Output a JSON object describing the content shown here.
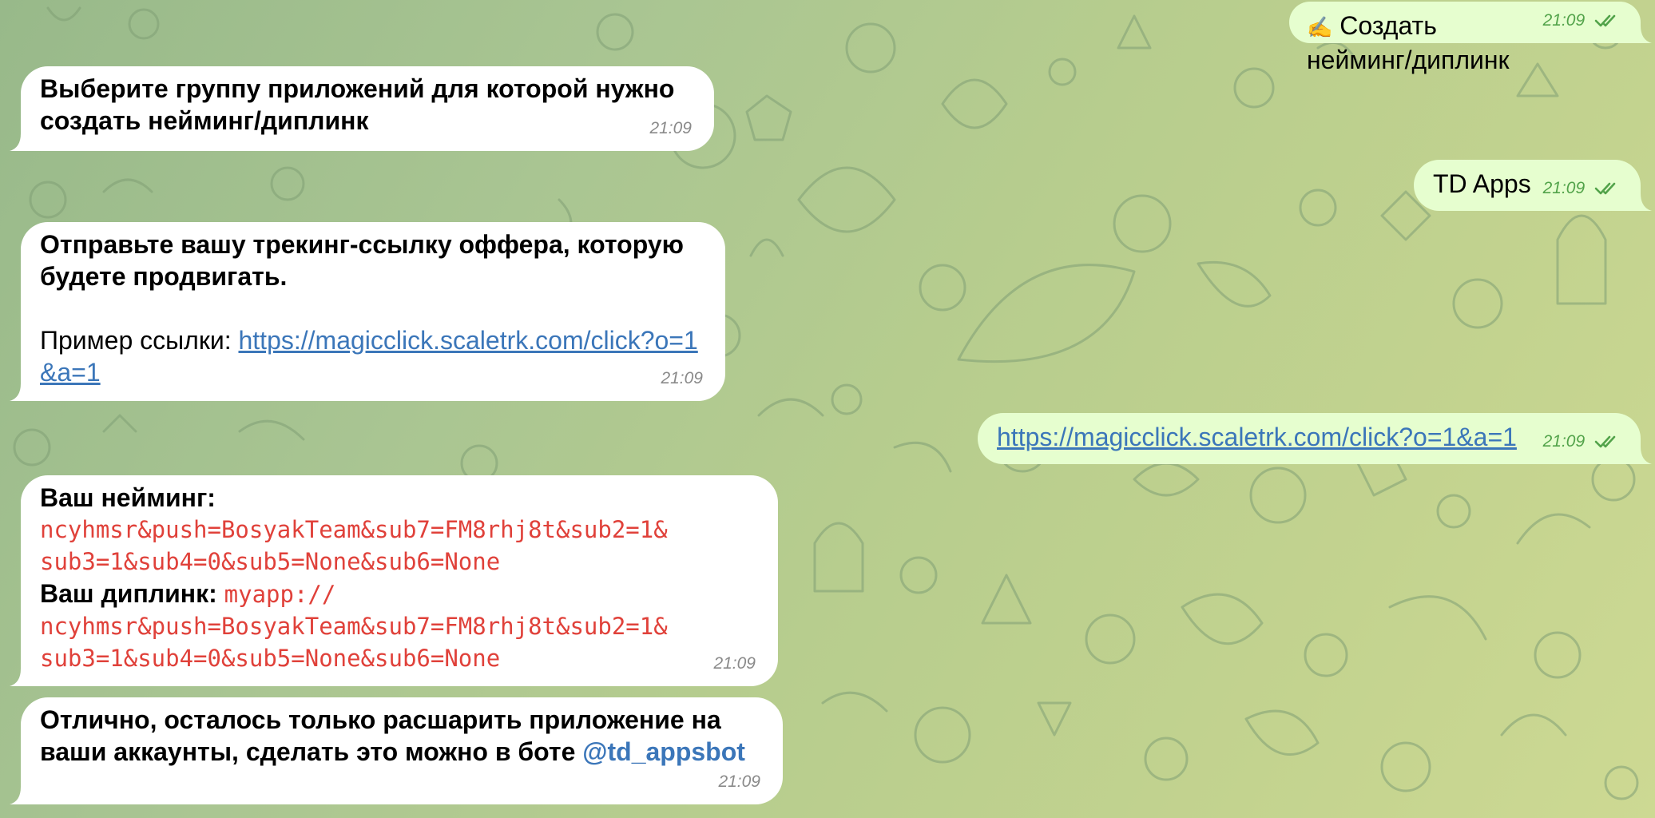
{
  "chat": {
    "messages": [
      {
        "id": "m1",
        "direction": "out",
        "icon": "writing-hand-icon",
        "icon_glyph": "✍️",
        "text": "Создать нейминг/диплинк",
        "time": "21:09",
        "status": "read"
      },
      {
        "id": "m2",
        "direction": "in",
        "text": "Выберите группу приложений для которой нужно создать нейминг/диплинк",
        "time": "21:09"
      },
      {
        "id": "m3",
        "direction": "out",
        "text": "TD Apps",
        "time": "21:09",
        "status": "read"
      },
      {
        "id": "m4",
        "direction": "in",
        "bold_text": "Отправьте вашу трекинг-ссылку оффера, которую будете продвигать.",
        "example_label": "Пример ссылки: ",
        "example_link": "https://magicclick.scaletrk.com/click?o=1&a=1",
        "time": "21:09"
      },
      {
        "id": "m5",
        "direction": "out",
        "link": "https://magicclick.scaletrk.com/click?o=1&a=1",
        "time": "21:09",
        "status": "read"
      },
      {
        "id": "m6",
        "direction": "in",
        "naming_label": "Ваш нейминг:",
        "naming_value_line1": "ncyhmsr&push=BosyakTeam&sub7=FM8rhj8t&sub2=1&",
        "naming_value_line2": "sub3=1&sub4=0&sub5=None&sub6=None",
        "deeplink_label": "Ваш диплинк: ",
        "deeplink_value_line0": "myapp://",
        "deeplink_value_line1": "ncyhmsr&push=BosyakTeam&sub7=FM8rhj8t&sub2=1&",
        "deeplink_value_line2": "sub3=1&sub4=0&sub5=None&sub6=None",
        "time": "21:09"
      },
      {
        "id": "m7",
        "direction": "in",
        "text_line1": "Отлично, осталось только расшарить приложение на",
        "text_line2": "ваши аккаунты, сделать это можно в боте ",
        "mention": "@td_appsbot",
        "time": "21:09"
      }
    ]
  },
  "colors": {
    "incoming_bubble": "#ffffff",
    "outgoing_bubble": "#e6fecf",
    "link": "#3b76b9",
    "code": "#e0413a",
    "read_checks": "#52a34a",
    "time_incoming": "#8a8a8a"
  }
}
